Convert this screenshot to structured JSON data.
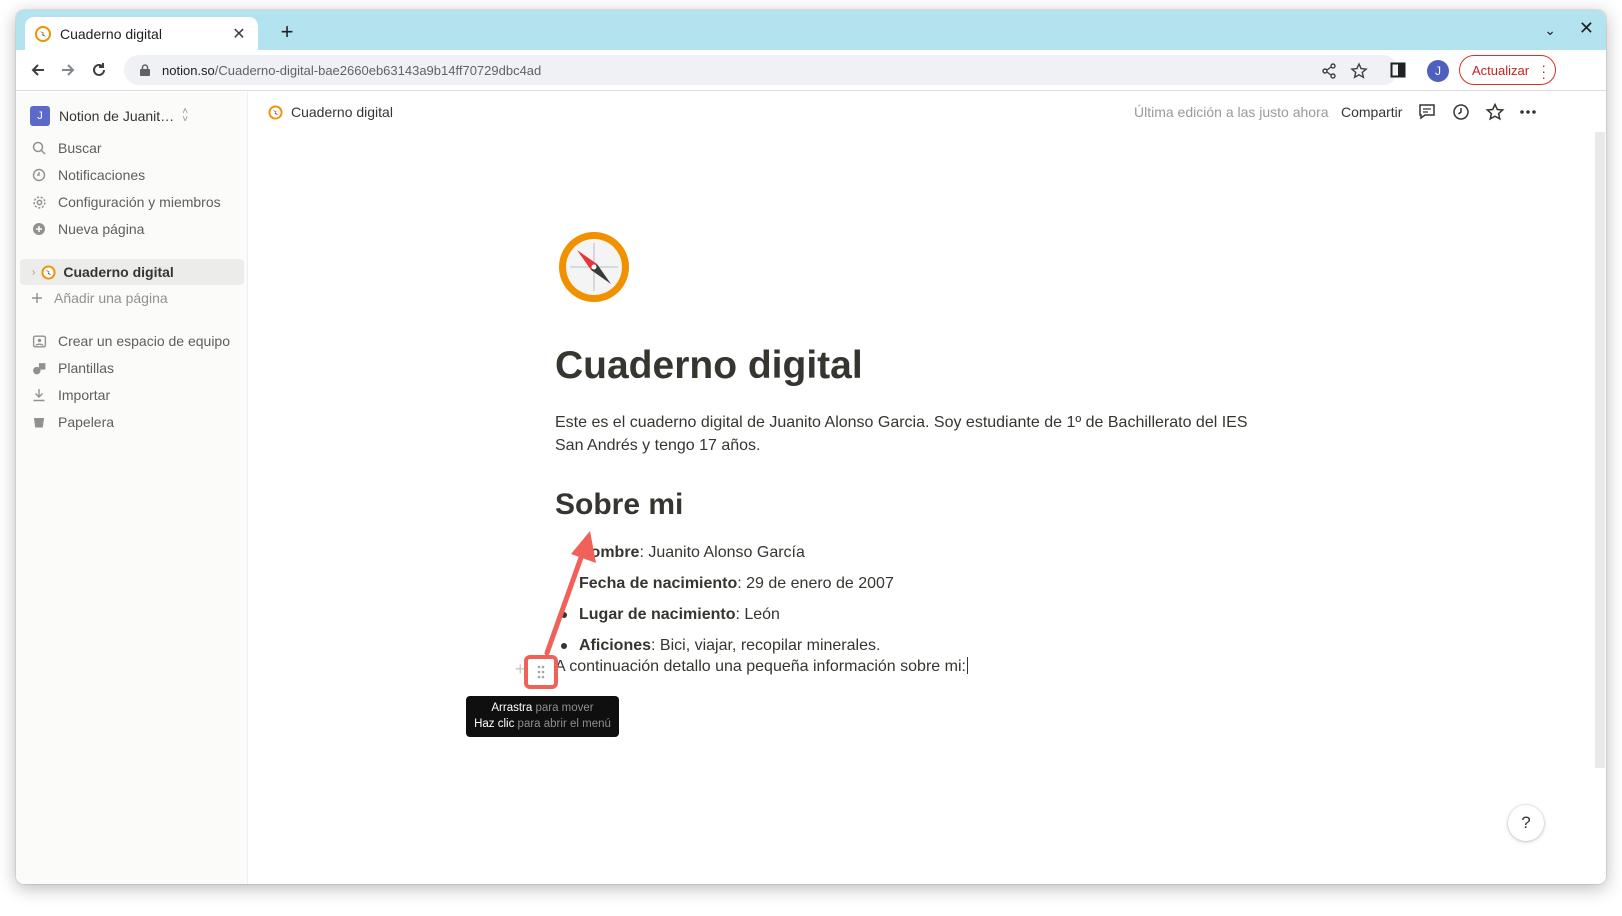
{
  "browser": {
    "tab_title": "Cuaderno digital",
    "url_host": "notion.so",
    "url_path": "/Cuaderno-digital-bae2660eb63143a9b14ff70729dbc4ad",
    "profile_initial": "J",
    "update_label": "Actualizar"
  },
  "sidebar": {
    "workspace_initial": "J",
    "workspace_name": "Notion de Juanit…",
    "items": [
      {
        "label": "Buscar",
        "icon": "search-icon"
      },
      {
        "label": "Notificaciones",
        "icon": "clock-icon"
      },
      {
        "label": "Configuración y miembros",
        "icon": "gear-icon"
      },
      {
        "label": "Nueva página",
        "icon": "plus-circle-icon"
      }
    ],
    "page": "Cuaderno digital",
    "add_page": "Añadir una página",
    "bottom_items": [
      {
        "label": "Crear un espacio de equipo",
        "icon": "teamspace-icon"
      },
      {
        "label": "Plantillas",
        "icon": "templates-icon"
      },
      {
        "label": "Importar",
        "icon": "import-icon"
      },
      {
        "label": "Papelera",
        "icon": "trash-icon"
      }
    ]
  },
  "topbar": {
    "breadcrumb": "Cuaderno digital",
    "edited": "Última edición a las justo ahora",
    "share": "Compartir"
  },
  "page": {
    "title": "Cuaderno digital",
    "intro": "Este es el cuaderno digital de Juanito Alonso Garcia. Soy estudiante de 1º de Bachillerato del IES San Andrés y tengo 17 años.",
    "heading": "Sobre mi",
    "bullets": [
      {
        "label": "Nombre",
        "value": ": Juanito Alonso García"
      },
      {
        "label": "Fecha de nacimiento",
        "value": ": 29 de enero de 2007"
      },
      {
        "label": "Lugar de nacimiento",
        "value": ": León"
      },
      {
        "label": "Aficiones",
        "value": ": Bici, viajar, recopilar minerales."
      }
    ],
    "paragraph": "A continuación detallo una pequeña información sobre mi:"
  },
  "tooltip": {
    "line1_strong": "Arrastra",
    "line1_dim": " para mover",
    "line2_strong": "Haz clic",
    "line2_dim": " para abrir el menú"
  },
  "help_label": "?",
  "colors": {
    "tab_bar": "#b2e3ef",
    "annotation": "#f06259",
    "notion_text": "#37352f"
  }
}
